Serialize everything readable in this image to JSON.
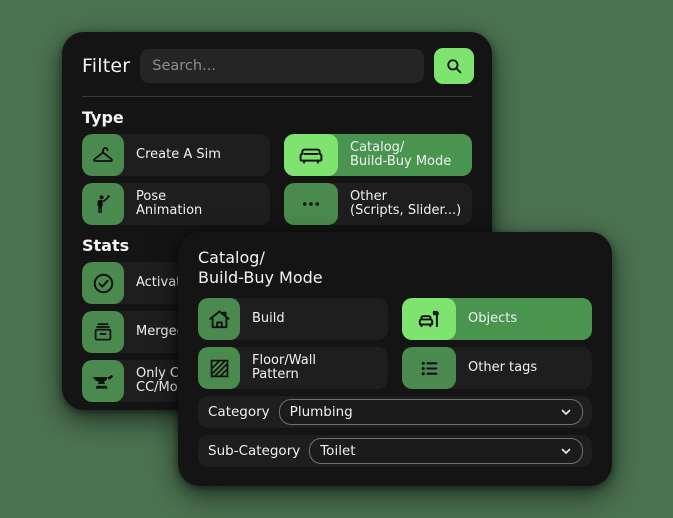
{
  "background_color": "#4b7251",
  "accent_bright": "#7fe36f",
  "accent_green": "#49954f",
  "icon_tile_green": "#4b8a4f",
  "panel_bg": "#141414",
  "row_bg": "#1e1e1e",
  "filter_panel": {
    "title": "Filter",
    "search": {
      "placeholder": "Search...",
      "value": "",
      "button_icon": "search-icon"
    },
    "sections": [
      {
        "label": "Type",
        "options": [
          {
            "label": "Create A Sim",
            "icon": "clothes-hanger-icon",
            "selected": false
          },
          {
            "label": "Catalog/\nBuild-Buy Mode",
            "icon": "sofa-icon",
            "selected": true
          },
          {
            "label": "Pose\nAnimation",
            "icon": "person-posing-icon",
            "selected": false
          },
          {
            "label": "Other\n(Scripts, Slider...)",
            "icon": "ellipsis-icon",
            "selected": false
          }
        ]
      },
      {
        "label": "Stats",
        "options": [
          {
            "label": "Activated",
            "icon": "check-circle-icon",
            "selected": false
          },
          {
            "label": "Merged",
            "icon": "archive-box-icon",
            "selected": false
          },
          {
            "label": "Only Curs\nCC/Mods",
            "icon": "anvil-icon",
            "selected": false
          }
        ]
      }
    ]
  },
  "catalog_panel": {
    "title": "Catalog/\nBuild-Buy Mode",
    "options": [
      {
        "label": "Build",
        "icon": "house-icon",
        "selected": false
      },
      {
        "label": "Objects",
        "icon": "armchair-lamp-icon",
        "selected": true
      },
      {
        "label": "Floor/Wall\nPattern",
        "icon": "diagonal-pattern-icon",
        "selected": false
      },
      {
        "label": "Other tags",
        "icon": "bulleted-list-icon",
        "selected": false
      }
    ],
    "dropdowns": [
      {
        "label": "Category",
        "value": "Plumbing"
      },
      {
        "label": "Sub-Category",
        "value": "Toilet"
      }
    ]
  }
}
